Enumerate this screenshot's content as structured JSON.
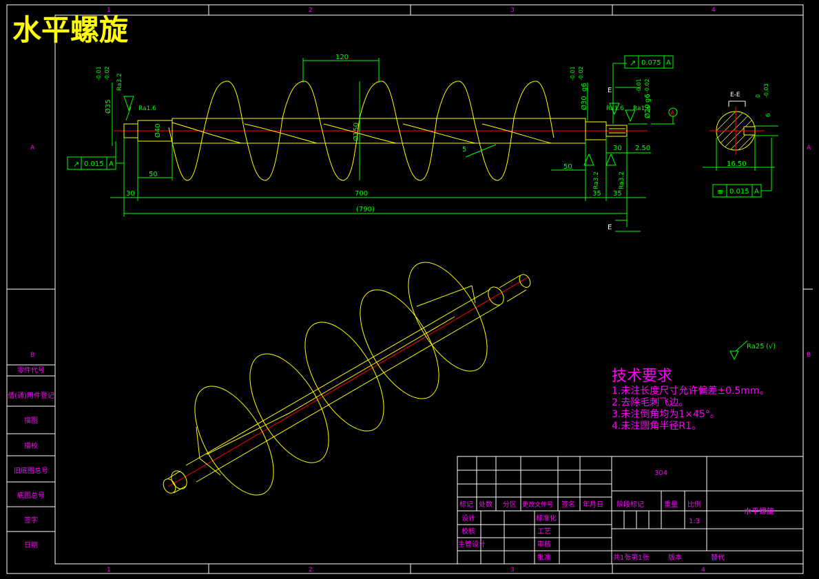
{
  "title": "水平螺旋",
  "zone_numbers": [
    "1",
    "2",
    "3",
    "4"
  ],
  "zone_letters": [
    "A",
    "B"
  ],
  "dimensions": {
    "pitch": "120",
    "dia_flight": "Ø150",
    "dia_shaft": "Ø40",
    "dia_left": "Ø35",
    "dia_left_tol_top": "-0.01",
    "dia_left_tol_bot": "-0.02",
    "dia_right": "Ø30",
    "dia_right_fit": "g6",
    "dia_right_tol_top": "-0.01",
    "dia_right_tol_bot": "-0.02",
    "dia_right2": "Ø20",
    "dia_right2_fit": "g6",
    "dia_right2_tol_top": "-0.01",
    "dia_right2_tol_bot": "-0.02",
    "len_50_left": "50",
    "len_50_right": "50",
    "len_30_left": "30",
    "len_700": "700",
    "len_790": "(790)",
    "len_35a": "35",
    "len_35b": "35",
    "len_30_right": "30",
    "len_250": "2.50",
    "thickness": "5",
    "ra_a": "Ra1.6",
    "ra_b": "Ra3.2",
    "ra_c": "Ra1.6",
    "ra_d": "Ra1.6",
    "ra_e": "Ra3.2",
    "ra_f": "Ra3.2",
    "tol_runout_left": "0.015",
    "tol_runout_right": "0.075",
    "datum": "A",
    "section_label": "E",
    "section_title": "E-E",
    "section_width": "16.50",
    "section_key": "6",
    "section_key_tol_top": "0",
    "section_key_tol_bot": "-0.03",
    "sym_tol": "0.015"
  },
  "surface_default": "Ra25",
  "tech": {
    "heading": "技术要求",
    "items": [
      "1.未注长度尺寸允许偏差±0.5mm。",
      "2.去除毛刺飞边。",
      "3.未注倒角均为1×45°。",
      "4.未注圆角半径R1。"
    ]
  },
  "left_column": [
    "借(通)用件登记",
    "描图",
    "描校",
    "旧底图总号",
    "底图总号",
    "签字",
    "日期"
  ],
  "left_header": "零件代号",
  "title_block": {
    "material": "304",
    "drawing_name": "水平螺旋",
    "labels": [
      "标记",
      "处数",
      "分区",
      "更改文件号",
      "签名",
      "年月日"
    ],
    "stage_labels": [
      "阶段标记",
      "重量",
      "比例"
    ],
    "scale": "1:3",
    "design": "设计",
    "standardize": "标准化",
    "check": "校核",
    "process": "工艺",
    "chief": "主管设计",
    "review": "审核",
    "approve": "批准",
    "sheets": "共1张第1张",
    "version": "版本",
    "replace": "替代"
  },
  "colors": {
    "border": "#ffffff",
    "part": "#ffff00",
    "dim": "#00ff00",
    "center": "#ff0000",
    "text": "#ff00ff",
    "title": "#ffff00"
  }
}
